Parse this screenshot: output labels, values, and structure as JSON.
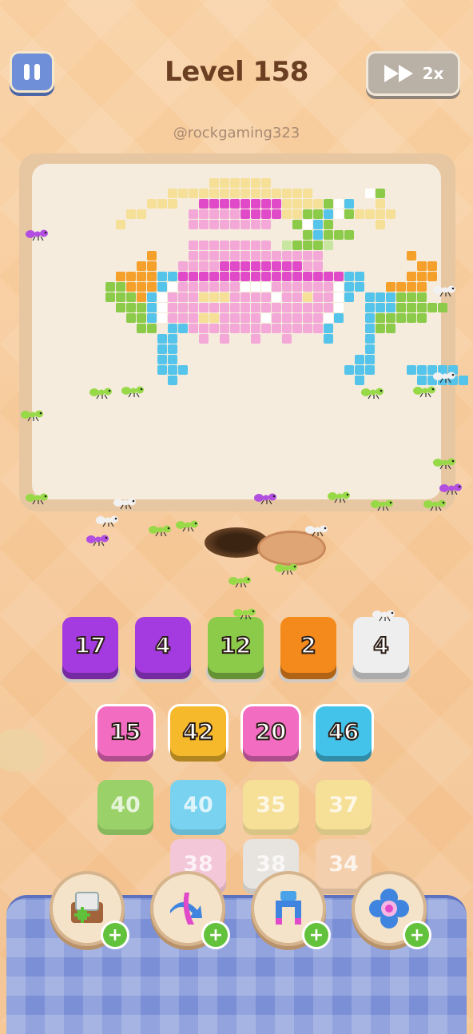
{
  "header": {
    "level_title": "Level 158",
    "speed_label": "2x"
  },
  "watermark": "@rockgaming323",
  "colors": {
    "purple": "#a33be0",
    "green": "#8ccb4a",
    "orange": "#f48a1c",
    "white": "#eeeeee",
    "pink": "#f26cc2",
    "yellow": "#f6b92b",
    "cyan": "#44c3ea",
    "lightgreen": "#9ad169",
    "lightcyan": "#79d2ef",
    "lightyellow": "#f6df97",
    "lightpink": "#f3c6d8",
    "lightgray": "#e7e3df",
    "peach": "#f4cfae"
  },
  "queue": [
    {
      "value": "17",
      "color": "purple"
    },
    {
      "value": "4",
      "color": "purple"
    },
    {
      "value": "12",
      "color": "green"
    },
    {
      "value": "2",
      "color": "orange"
    },
    {
      "value": "4",
      "color": "white"
    }
  ],
  "grid_rows": [
    [
      {
        "value": "15",
        "color": "pink"
      },
      {
        "value": "42",
        "color": "yellow"
      },
      {
        "value": "20",
        "color": "pink"
      },
      {
        "value": "46",
        "color": "cyan"
      }
    ],
    [
      {
        "value": "40",
        "color": "lightgreen"
      },
      {
        "value": "40",
        "color": "lightcyan"
      },
      {
        "value": "35",
        "color": "lightyellow"
      },
      {
        "value": "37",
        "color": "lightyellow"
      }
    ],
    [
      {
        "value": "38",
        "color": "lightpink"
      },
      {
        "value": "38",
        "color": "lightgray"
      },
      {
        "value": "34",
        "color": "peach"
      }
    ]
  ],
  "boosters": [
    {
      "icon": "add-slot-icon"
    },
    {
      "icon": "shuffle-arrows-icon"
    },
    {
      "icon": "magnet-claw-icon"
    },
    {
      "icon": "flower-freeze-icon"
    }
  ]
}
